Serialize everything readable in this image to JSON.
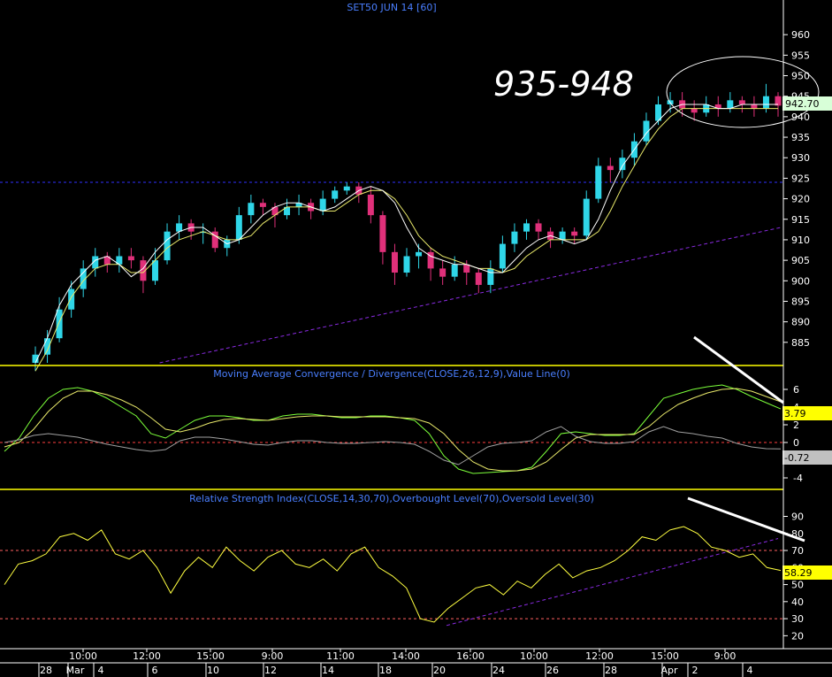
{
  "chart_data": [
    {
      "type": "candlestick",
      "title": "SET50 JUN 14  [60]",
      "ylim": [
        880,
        965
      ],
      "yticks": [
        885,
        890,
        895,
        900,
        905,
        910,
        915,
        920,
        925,
        930,
        935,
        940,
        945,
        950,
        955,
        960
      ],
      "last_price": "942.70",
      "annotation": "935-948",
      "horizontal_line": 924,
      "trendline": {
        "from": [
          0.2,
          880
        ],
        "to": [
          1.0,
          913
        ]
      },
      "ma_fast": [
        880,
        886,
        894,
        899,
        902,
        905,
        906,
        904,
        901,
        903,
        907,
        910,
        912,
        913,
        913,
        911,
        909,
        910,
        913,
        916,
        918,
        919,
        919,
        918,
        917,
        918,
        920,
        922,
        923,
        922,
        919,
        913,
        908,
        906,
        905,
        904,
        904,
        903,
        902,
        902,
        905,
        908,
        910,
        911,
        910,
        909,
        910,
        915,
        922,
        928,
        932,
        936,
        939,
        942,
        943,
        943,
        943,
        942,
        942,
        943,
        943,
        943,
        943
      ],
      "ma_slow": [
        878,
        883,
        890,
        896,
        900,
        903,
        904,
        904,
        902,
        902,
        905,
        908,
        910,
        911,
        912,
        911,
        910,
        910,
        911,
        914,
        916,
        918,
        918,
        918,
        917,
        917,
        919,
        921,
        922,
        922,
        920,
        916,
        911,
        908,
        906,
        905,
        904,
        903,
        903,
        902,
        903,
        906,
        908,
        910,
        910,
        910,
        910,
        912,
        917,
        923,
        928,
        933,
        937,
        940,
        942,
        942,
        942,
        942,
        942,
        942,
        942,
        942,
        942
      ],
      "candles": [
        {
          "o": 880,
          "c": 882,
          "h": 884,
          "l": 878
        },
        {
          "o": 882,
          "c": 886,
          "h": 888,
          "l": 880
        },
        {
          "o": 886,
          "c": 893,
          "h": 896,
          "l": 885
        },
        {
          "o": 893,
          "c": 898,
          "h": 900,
          "l": 891
        },
        {
          "o": 898,
          "c": 903,
          "h": 905,
          "l": 896
        },
        {
          "o": 903,
          "c": 906,
          "h": 908,
          "l": 901
        },
        {
          "o": 906,
          "c": 904,
          "h": 907,
          "l": 902
        },
        {
          "o": 904,
          "c": 906,
          "h": 908,
          "l": 902
        },
        {
          "o": 906,
          "c": 905,
          "h": 908,
          "l": 903
        },
        {
          "o": 905,
          "c": 900,
          "h": 906,
          "l": 897
        },
        {
          "o": 900,
          "c": 905,
          "h": 908,
          "l": 899
        },
        {
          "o": 905,
          "c": 912,
          "h": 914,
          "l": 904
        },
        {
          "o": 912,
          "c": 914,
          "h": 916,
          "l": 910
        },
        {
          "o": 914,
          "c": 912,
          "h": 915,
          "l": 910
        },
        {
          "o": 912,
          "c": 912,
          "h": 914,
          "l": 909
        },
        {
          "o": 912,
          "c": 908,
          "h": 913,
          "l": 907
        },
        {
          "o": 908,
          "c": 910,
          "h": 911,
          "l": 906
        },
        {
          "o": 910,
          "c": 916,
          "h": 918,
          "l": 909
        },
        {
          "o": 916,
          "c": 919,
          "h": 921,
          "l": 914
        },
        {
          "o": 919,
          "c": 918,
          "h": 920,
          "l": 916
        },
        {
          "o": 918,
          "c": 916,
          "h": 919,
          "l": 913
        },
        {
          "o": 916,
          "c": 918,
          "h": 920,
          "l": 915
        },
        {
          "o": 918,
          "c": 919,
          "h": 921,
          "l": 916
        },
        {
          "o": 919,
          "c": 917,
          "h": 920,
          "l": 915
        },
        {
          "o": 917,
          "c": 920,
          "h": 922,
          "l": 916
        },
        {
          "o": 920,
          "c": 922,
          "h": 923,
          "l": 919
        },
        {
          "o": 922,
          "c": 923,
          "h": 924,
          "l": 921
        },
        {
          "o": 923,
          "c": 921,
          "h": 924,
          "l": 919
        },
        {
          "o": 921,
          "c": 916,
          "h": 923,
          "l": 914
        },
        {
          "o": 916,
          "c": 907,
          "h": 917,
          "l": 904
        },
        {
          "o": 907,
          "c": 902,
          "h": 909,
          "l": 899
        },
        {
          "o": 902,
          "c": 906,
          "h": 908,
          "l": 901
        },
        {
          "o": 906,
          "c": 907,
          "h": 909,
          "l": 903
        },
        {
          "o": 907,
          "c": 903,
          "h": 908,
          "l": 900
        },
        {
          "o": 903,
          "c": 901,
          "h": 905,
          "l": 899
        },
        {
          "o": 901,
          "c": 904,
          "h": 906,
          "l": 900
        },
        {
          "o": 904,
          "c": 902,
          "h": 905,
          "l": 899
        },
        {
          "o": 902,
          "c": 899,
          "h": 903,
          "l": 897
        },
        {
          "o": 899,
          "c": 903,
          "h": 905,
          "l": 897
        },
        {
          "o": 903,
          "c": 909,
          "h": 911,
          "l": 902
        },
        {
          "o": 909,
          "c": 912,
          "h": 914,
          "l": 907
        },
        {
          "o": 912,
          "c": 914,
          "h": 915,
          "l": 910
        },
        {
          "o": 914,
          "c": 912,
          "h": 915,
          "l": 910
        },
        {
          "o": 912,
          "c": 910,
          "h": 913,
          "l": 908
        },
        {
          "o": 910,
          "c": 912,
          "h": 913,
          "l": 909
        },
        {
          "o": 912,
          "c": 911,
          "h": 913,
          "l": 909
        },
        {
          "o": 911,
          "c": 920,
          "h": 922,
          "l": 910
        },
        {
          "o": 920,
          "c": 928,
          "h": 930,
          "l": 919
        },
        {
          "o": 928,
          "c": 927,
          "h": 930,
          "l": 924
        },
        {
          "o": 927,
          "c": 930,
          "h": 932,
          "l": 925
        },
        {
          "o": 930,
          "c": 934,
          "h": 936,
          "l": 928
        },
        {
          "o": 934,
          "c": 939,
          "h": 941,
          "l": 933
        },
        {
          "o": 939,
          "c": 943,
          "h": 945,
          "l": 938
        },
        {
          "o": 943,
          "c": 944,
          "h": 946,
          "l": 941
        },
        {
          "o": 944,
          "c": 942,
          "h": 946,
          "l": 940
        },
        {
          "o": 942,
          "c": 941,
          "h": 944,
          "l": 939
        },
        {
          "o": 941,
          "c": 943,
          "h": 945,
          "l": 940
        },
        {
          "o": 943,
          "c": 942,
          "h": 945,
          "l": 940
        },
        {
          "o": 942,
          "c": 944,
          "h": 946,
          "l": 941
        },
        {
          "o": 944,
          "c": 943,
          "h": 945,
          "l": 941
        },
        {
          "o": 943,
          "c": 942,
          "h": 945,
          "l": 940
        },
        {
          "o": 942,
          "c": 945,
          "h": 948,
          "l": 941
        },
        {
          "o": 945,
          "c": 942.7,
          "h": 946,
          "l": 940
        }
      ]
    },
    {
      "type": "line",
      "title": "Moving Average Convergence / Divergence(CLOSE,26,12,9),Value Line(0)",
      "ylim": [
        -5,
        7
      ],
      "yticks": [
        -4,
        -2,
        0,
        2,
        4,
        6
      ],
      "values_label_macd": "3.79",
      "values_label_hist": "-0.72",
      "zero_line": 0,
      "series": [
        {
          "values": [
            -1,
            0.5,
            3,
            5,
            6,
            6.2,
            5.8,
            5,
            4,
            3,
            1,
            0.5,
            1.5,
            2.5,
            3,
            3,
            2.8,
            2.5,
            2.5,
            3,
            3.2,
            3.2,
            3,
            2.8,
            2.8,
            3,
            3,
            2.8,
            2.5,
            1,
            -1.5,
            -3,
            -3.5,
            -3.4,
            -3.3,
            -3.2,
            -2.8,
            -1,
            1,
            1.2,
            1,
            0.8,
            0.8,
            1,
            3,
            5,
            5.5,
            6,
            6.3,
            6.5,
            6,
            5.2,
            4.5,
            3.79
          ]
        },
        {
          "values": [
            -0.5,
            0,
            1.5,
            3.5,
            5,
            5.8,
            5.8,
            5.4,
            4.8,
            4,
            2.8,
            1.5,
            1.2,
            1.6,
            2.2,
            2.6,
            2.7,
            2.6,
            2.5,
            2.7,
            2.9,
            3,
            3,
            2.9,
            2.9,
            2.9,
            2.9,
            2.8,
            2.7,
            2.2,
            1,
            -0.8,
            -2.2,
            -3,
            -3.2,
            -3.2,
            -3,
            -2.2,
            -0.8,
            0.5,
            0.9,
            0.9,
            0.9,
            0.9,
            1.8,
            3.2,
            4.3,
            5,
            5.6,
            6,
            6.1,
            5.8,
            5.2,
            4.6
          ]
        },
        {
          "values": [
            0,
            0.3,
            0.8,
            1,
            0.8,
            0.6,
            0.2,
            -0.2,
            -0.5,
            -0.8,
            -1,
            -0.8,
            0.2,
            0.6,
            0.6,
            0.4,
            0.1,
            -0.2,
            -0.3,
            0,
            0.2,
            0.2,
            0,
            -0.1,
            -0.1,
            0,
            0.1,
            0,
            -0.2,
            -1,
            -2,
            -2.5,
            -1.5,
            -0.5,
            -0.1,
            0,
            0.2,
            1.2,
            1.8,
            0.7,
            0.1,
            -0.1,
            -0.1,
            0.1,
            1.2,
            1.8,
            1.2,
            1,
            0.7,
            0.5,
            -0.1,
            -0.5,
            -0.7,
            -0.72
          ]
        }
      ]
    },
    {
      "type": "line",
      "title": "Relative Strength Index(CLOSE,14,30,70),Overbought Level(70),Oversold Level(30)",
      "ylim": [
        15,
        97
      ],
      "yticks": [
        20,
        30,
        40,
        50,
        60,
        70,
        80,
        90
      ],
      "last_value": "58.29",
      "overbought": 70,
      "oversold": 30,
      "series": [
        {
          "values": [
            50,
            62,
            64,
            68,
            78,
            80,
            76,
            82,
            68,
            65,
            70,
            60,
            45,
            58,
            66,
            60,
            72,
            64,
            58,
            66,
            70,
            62,
            60,
            65,
            58,
            68,
            72,
            60,
            55,
            48,
            30,
            28,
            36,
            42,
            48,
            50,
            44,
            52,
            48,
            56,
            62,
            54,
            58,
            60,
            64,
            70,
            78,
            76,
            82,
            84,
            80,
            72,
            70,
            66,
            68,
            60,
            58.29
          ]
        }
      ]
    }
  ],
  "time_axis": {
    "time_labels": [
      "10:00",
      "12:00",
      "15:00",
      "9:00",
      "11:00",
      "14:00",
      "16:00",
      "10:00",
      "12:00",
      "15:00",
      "9:00"
    ],
    "date_labels": [
      "28",
      "Mar",
      "4",
      "6",
      "10",
      "12",
      "14",
      "18",
      "20",
      "24",
      "26",
      "28",
      "Apr",
      "2",
      "4"
    ]
  }
}
